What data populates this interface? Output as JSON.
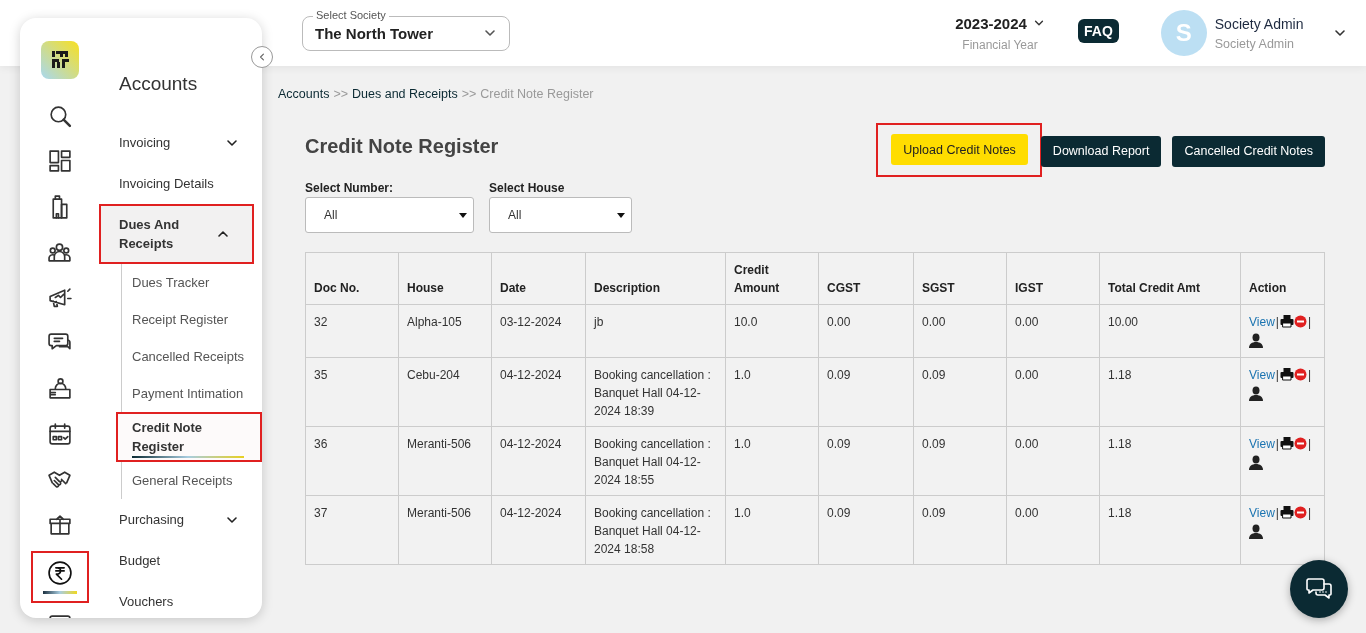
{
  "header": {
    "society_select": {
      "label": "Select Society",
      "value": "The North Tower"
    },
    "financial_year": {
      "value": "2023-2024",
      "label": "Financial Year"
    },
    "faq": "FAQ",
    "user": {
      "initial": "S",
      "name": "Society Admin",
      "role": "Society Admin"
    }
  },
  "sidebar": {
    "rail": [
      {
        "kind": "logo",
        "selected": false,
        "highlighted": false
      },
      {
        "kind": "search",
        "selected": false,
        "highlighted": false
      },
      {
        "kind": "dashboard",
        "selected": false,
        "highlighted": false
      },
      {
        "kind": "building",
        "selected": false,
        "highlighted": false
      },
      {
        "kind": "people",
        "selected": false,
        "highlighted": false
      },
      {
        "kind": "megaphone",
        "selected": false,
        "highlighted": false
      },
      {
        "kind": "chat",
        "selected": false,
        "highlighted": false
      },
      {
        "kind": "desk",
        "selected": false,
        "highlighted": false
      },
      {
        "kind": "calendar",
        "selected": false,
        "highlighted": false
      },
      {
        "kind": "handshake",
        "selected": false,
        "highlighted": false
      },
      {
        "kind": "box",
        "selected": false,
        "highlighted": false
      },
      {
        "kind": "rupee",
        "selected": true,
        "highlighted": true
      },
      {
        "kind": "monitor",
        "selected": false,
        "highlighted": false
      }
    ],
    "title": "Accounts",
    "menu": [
      {
        "label": "Invoicing",
        "kind": "group",
        "expanded": false,
        "highlighted": false
      },
      {
        "label": "Invoicing Details",
        "kind": "link",
        "highlighted": false
      },
      {
        "label": "Dues And Receipts",
        "kind": "group",
        "expanded": true,
        "highlighted": true,
        "children": [
          {
            "label": "Dues Tracker",
            "selected": false,
            "highlighted": false
          },
          {
            "label": "Receipt Register",
            "selected": false,
            "highlighted": false
          },
          {
            "label": "Cancelled Receipts",
            "selected": false,
            "highlighted": false
          },
          {
            "label": "Payment Intimation",
            "selected": false,
            "highlighted": false
          },
          {
            "label": "Credit Note Register",
            "selected": true,
            "highlighted": true
          },
          {
            "label": "General Receipts",
            "selected": false,
            "highlighted": false
          }
        ]
      },
      {
        "label": "Purchasing",
        "kind": "group",
        "expanded": false,
        "highlighted": false
      },
      {
        "label": "Budget",
        "kind": "link",
        "highlighted": false
      },
      {
        "label": "Vouchers",
        "kind": "link",
        "highlighted": false
      }
    ]
  },
  "breadcrumb": {
    "separator": ">>",
    "items": [
      {
        "label": "Accounts",
        "current": false
      },
      {
        "label": "Dues and Receipts",
        "current": false
      },
      {
        "label": "Credit Note Register",
        "current": true
      }
    ]
  },
  "page_title": "Credit Note Register",
  "buttons": [
    {
      "label": "Upload Credit Notes",
      "kind": "primary",
      "highlighted": true
    },
    {
      "label": "Download Report",
      "kind": "dark",
      "highlighted": false
    },
    {
      "label": "Cancelled Credit Notes",
      "kind": "dark",
      "highlighted": false
    }
  ],
  "filters": [
    {
      "label": "Select Number:",
      "value": "All"
    },
    {
      "label": "Select House",
      "value": "All"
    }
  ],
  "table": {
    "columns": [
      "Doc No.",
      "House",
      "Date",
      "Description",
      "Credit Amount",
      "CGST",
      "SGST",
      "IGST",
      "Total Credit Amt",
      "Action"
    ],
    "rows": [
      {
        "cells": [
          "32",
          "Alpha-105",
          "03-12-2024",
          "jb",
          "10.0",
          "0.00",
          "0.00",
          "0.00",
          "10.00"
        ],
        "actions": [
          {
            "kind": "link",
            "label": "View"
          },
          {
            "kind": "text",
            "label": "|"
          },
          {
            "kind": "print"
          },
          {
            "kind": "cancel"
          },
          {
            "kind": "text",
            "label": "|"
          },
          {
            "kind": "user"
          }
        ]
      },
      {
        "cells": [
          "35",
          "Cebu-204",
          "04-12-2024",
          "Booking cancellation : Banquet Hall 04-12-2024 18:39",
          "1.0",
          "0.09",
          "0.09",
          "0.00",
          "1.18"
        ],
        "actions": [
          {
            "kind": "link",
            "label": "View"
          },
          {
            "kind": "text",
            "label": "|"
          },
          {
            "kind": "print"
          },
          {
            "kind": "cancel"
          },
          {
            "kind": "text",
            "label": "|"
          },
          {
            "kind": "user"
          }
        ]
      },
      {
        "cells": [
          "36",
          "Meranti-506",
          "04-12-2024",
          "Booking cancellation : Banquet Hall 04-12-2024 18:55",
          "1.0",
          "0.09",
          "0.09",
          "0.00",
          "1.18"
        ],
        "actions": [
          {
            "kind": "link",
            "label": "View"
          },
          {
            "kind": "text",
            "label": "|"
          },
          {
            "kind": "print"
          },
          {
            "kind": "cancel"
          },
          {
            "kind": "text",
            "label": "|"
          },
          {
            "kind": "user"
          }
        ]
      },
      {
        "cells": [
          "37",
          "Meranti-506",
          "04-12-2024",
          "Booking cancellation : Banquet Hall 04-12-2024 18:58",
          "1.0",
          "0.09",
          "0.09",
          "0.00",
          "1.18"
        ],
        "actions": [
          {
            "kind": "link",
            "label": "View"
          },
          {
            "kind": "text",
            "label": "|"
          },
          {
            "kind": "print"
          },
          {
            "kind": "cancel"
          },
          {
            "kind": "text",
            "label": "|"
          },
          {
            "kind": "user"
          }
        ]
      }
    ]
  }
}
